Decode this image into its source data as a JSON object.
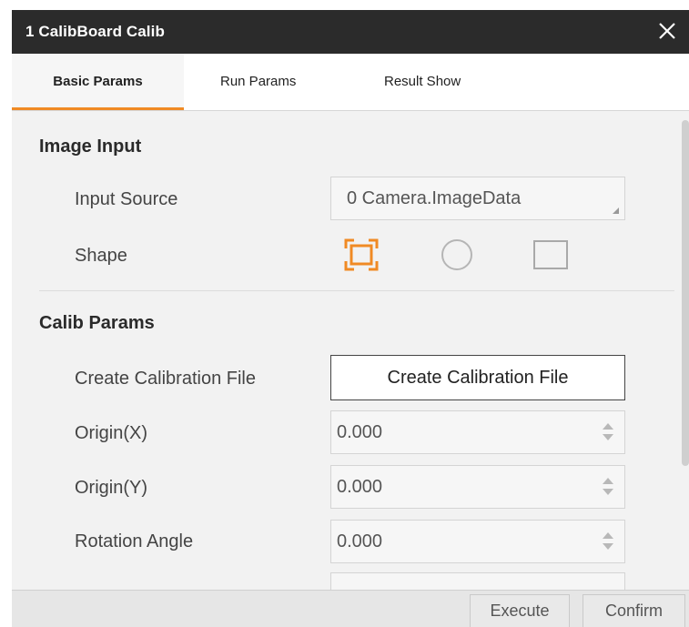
{
  "window": {
    "title": "1 CalibBoard Calib",
    "close_icon": "close-icon"
  },
  "tabs": [
    {
      "label": "Basic Params",
      "active": true
    },
    {
      "label": "Run Params",
      "active": false
    },
    {
      "label": "Result Show",
      "active": false
    }
  ],
  "image_input": {
    "section_title": "Image Input",
    "input_source_label": "Input Source",
    "input_source_value": "0 Camera.ImageData",
    "shape_label": "Shape",
    "shapes": [
      "rectangle-select-icon",
      "circle-icon",
      "square-icon"
    ],
    "selected_shape": "rectangle-select-icon"
  },
  "calib_params": {
    "section_title": "Calib Params",
    "create_file_label": "Create Calibration File",
    "create_file_button": "Create Calibration File",
    "origin_x_label": "Origin(X)",
    "origin_x_value": "0.000",
    "origin_y_label": "Origin(Y)",
    "origin_y_value": "0.000",
    "rotation_label": "Rotation Angle",
    "rotation_value": "0.000"
  },
  "footer": {
    "execute_label": "Execute",
    "confirm_label": "Confirm"
  },
  "colors": {
    "accent": "#f08a24",
    "titlebar": "#2b2b2b",
    "panel": "#f2f2f2"
  }
}
